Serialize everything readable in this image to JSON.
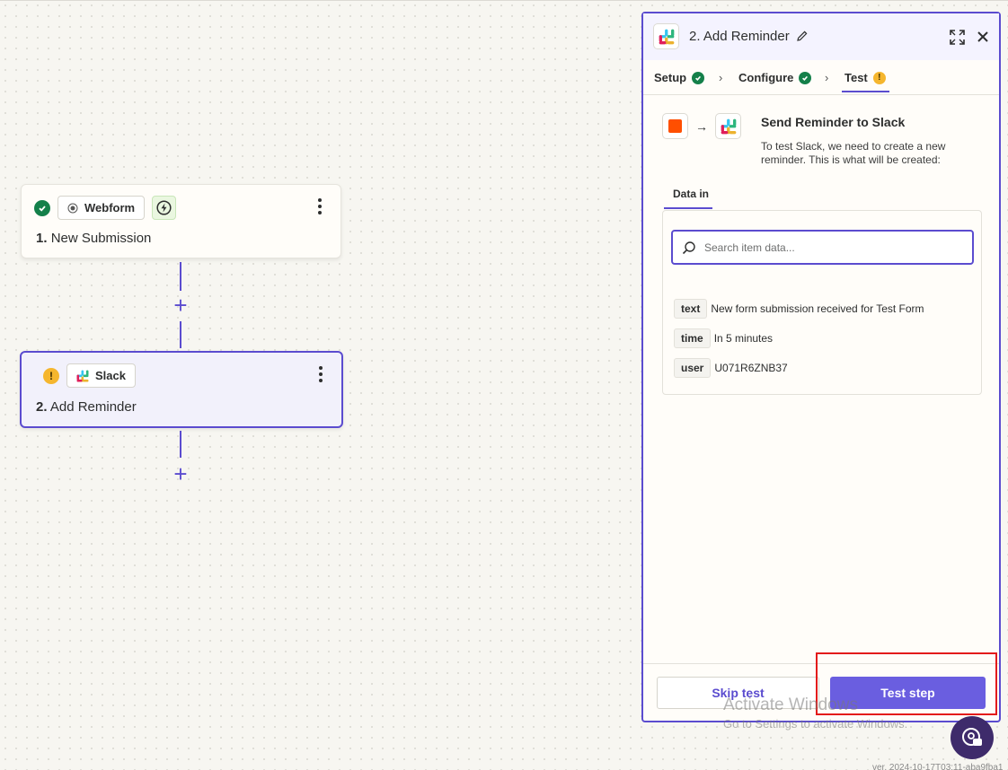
{
  "canvas": {
    "steps": [
      {
        "number": "1.",
        "title": "New Submission",
        "app_label": "Webform",
        "status": "success"
      },
      {
        "number": "2.",
        "title": "Add Reminder",
        "app_label": "Slack",
        "status": "warning"
      }
    ],
    "add_step_symbol": "+"
  },
  "panel": {
    "title": "2. Add Reminder",
    "tabs": [
      {
        "label": "Setup",
        "status": "success"
      },
      {
        "label": "Configure",
        "status": "success"
      },
      {
        "label": "Test",
        "status": "warning"
      }
    ],
    "tab_separator": "›",
    "flow_arrow": "→",
    "send_title": "Send Reminder to Slack",
    "send_description": "To test Slack, we need to create a new reminder. This is what will be created:",
    "data_in_tab": "Data in",
    "search": {
      "placeholder": "Search item data...",
      "value": ""
    },
    "fields": [
      {
        "key": "text",
        "value": "New form submission received for Test Form"
      },
      {
        "key": "time",
        "value": "In 5 minutes"
      },
      {
        "key": "user",
        "value": "U071R6ZNB37"
      }
    ],
    "skip_label": "Skip test",
    "test_label": "Test step"
  },
  "overlay": {
    "watermark_title": "Activate Windows",
    "watermark_sub": "Go to Settings to activate Windows.",
    "version": "ver. 2024-10-17T03:11-aba9fba1"
  },
  "colors": {
    "accent": "#5b4ccf",
    "button": "#6a5ee0",
    "success": "#14804a",
    "warning": "#f5b62e",
    "highlight": "#e31b1b",
    "webform_orange": "#ff4f00"
  }
}
